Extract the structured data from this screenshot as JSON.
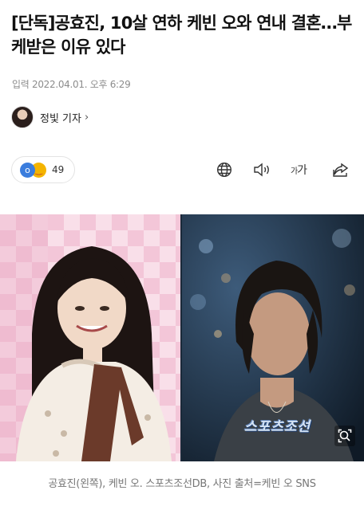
{
  "article": {
    "headline": "[단독]공효진, 10살 연하 케빈 오와 연내 결혼…부케받은 이유 있다",
    "meta": "입력 2022.04.01. 오후 6:29",
    "reporter": "정빛 기자",
    "reporter_chevron": "›"
  },
  "toolbar": {
    "reaction_count": "49",
    "fontsize_small": "가",
    "fontsize_large": "가",
    "icons": [
      "globe-icon",
      "speaker-icon",
      "font-size-icon",
      "share-icon"
    ]
  },
  "photo": {
    "watermark": "스포츠조선",
    "caption": "공효진(왼쪽), 케빈 오. 스포츠조선DB, 사진 출처=케빈 오 SNS"
  },
  "colors": {
    "meta_gray": "#8c8c8c",
    "caption_gray": "#777777",
    "reaction_blue": "#3b7ddd",
    "reaction_yellow": "#f4b400"
  }
}
